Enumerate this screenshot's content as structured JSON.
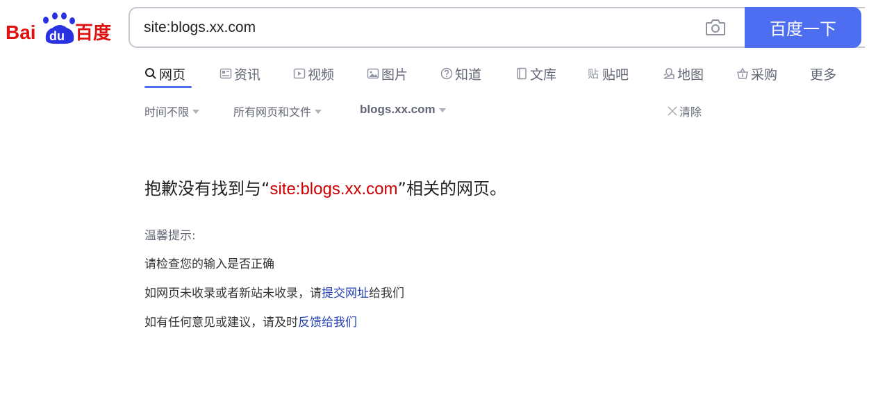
{
  "logo": {
    "text_latin": "Bai",
    "text_du": "du",
    "text_cn": "百度"
  },
  "search": {
    "query": "site:blogs.xx.com",
    "button_label": "百度一下"
  },
  "tabs": [
    {
      "label": "网页",
      "icon": "search-icon"
    },
    {
      "label": "资讯",
      "icon": "news-icon"
    },
    {
      "label": "视频",
      "icon": "video-icon"
    },
    {
      "label": "图片",
      "icon": "image-icon"
    },
    {
      "label": "知道",
      "icon": "question-icon"
    },
    {
      "label": "文库",
      "icon": "document-icon"
    },
    {
      "label": "贴吧",
      "icon": "tieba-icon"
    },
    {
      "label": "地图",
      "icon": "map-icon"
    },
    {
      "label": "采购",
      "icon": "basket-icon"
    },
    {
      "label": "更多"
    }
  ],
  "filters": {
    "time": "时间不限",
    "type": "所有网页和文件",
    "site": "blogs.xx.com",
    "clear": "清除"
  },
  "no_result": {
    "prefix": "抱歉没有找到与",
    "open_quote": "“",
    "query": "site:blogs.xx.com",
    "close_quote": "”",
    "suffix": "相关的网页。"
  },
  "tips": {
    "title": "温馨提示:",
    "line1": "请检查您的输入是否正确",
    "line2_prefix": "如网页未收录或者新站未收录，请",
    "line2_link": "提交网址",
    "line2_suffix": "给我们",
    "line3_prefix": "如有任何意见或建议，请及时",
    "line3_link": "反馈给我们"
  },
  "colors": {
    "accent": "#4e6ef2",
    "logo_red": "#de1010",
    "logo_blue": "#2932e1",
    "query_red": "#cc0000",
    "link_blue": "#2440b3"
  }
}
